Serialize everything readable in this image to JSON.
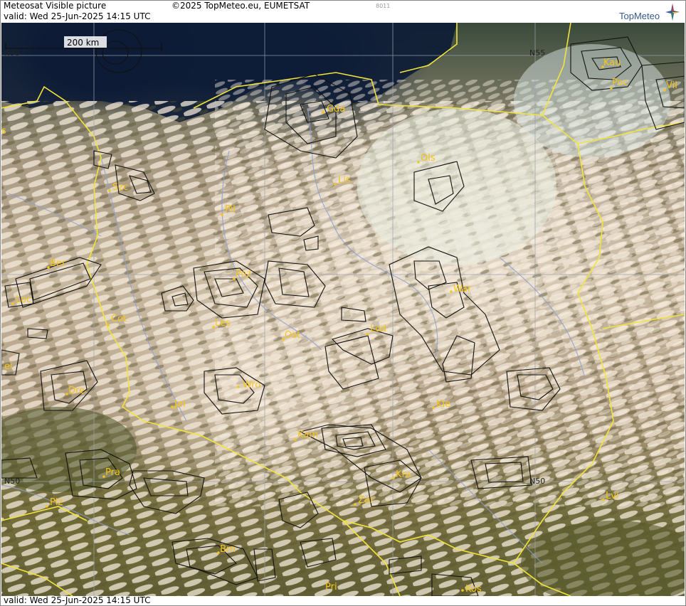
{
  "header": {
    "title": "Meteosat Visible picture",
    "valid": "valid:  Wed  25-Jun-2025  14:15 UTC",
    "copyright": "©2025 TopMeteo.eu, EUMETSAT",
    "code": "8011",
    "brand": "TopMeteo"
  },
  "footer": {
    "valid": "valid:  Wed  25-Jun-2025  14:15 UTC"
  },
  "scale": {
    "label": "200 km"
  },
  "lat_labels": {
    "n55_left": "N55",
    "n55_right": "N55",
    "n50_left": "N50",
    "n50_right": "N50"
  },
  "cities": {
    "gda": "Gda",
    "kau": "Kau",
    "poc": "Poc",
    "vil": "Vil",
    "ols": "Ols",
    "lis": "Lis",
    "szc": "Szc",
    "pil": "Pil",
    "ber": "Ber",
    "poz": "Poz",
    "loc": "Loc",
    "war": "War",
    "cot": "Cot",
    "les": "Les",
    "ost": "Ost",
    "lod": "Lod",
    "ei": "ei",
    "dre": "Dre",
    "wro": "Wro",
    "jel": "Jel",
    "kie": "Kie",
    "kam": "Kam",
    "pra": "Pra",
    "kra": "Kra",
    "plz": "Plz",
    "zar": "Zar",
    "lvi": "Lvi",
    "brn": "Brn",
    "pri": "Pri",
    "kos": "Kos",
    "s": "s"
  },
  "colors": {
    "city": "#f5c518",
    "border": "#f2e43a",
    "contour": "#111111",
    "river": "#8a9fd6",
    "grid": "#9aa0b0"
  }
}
